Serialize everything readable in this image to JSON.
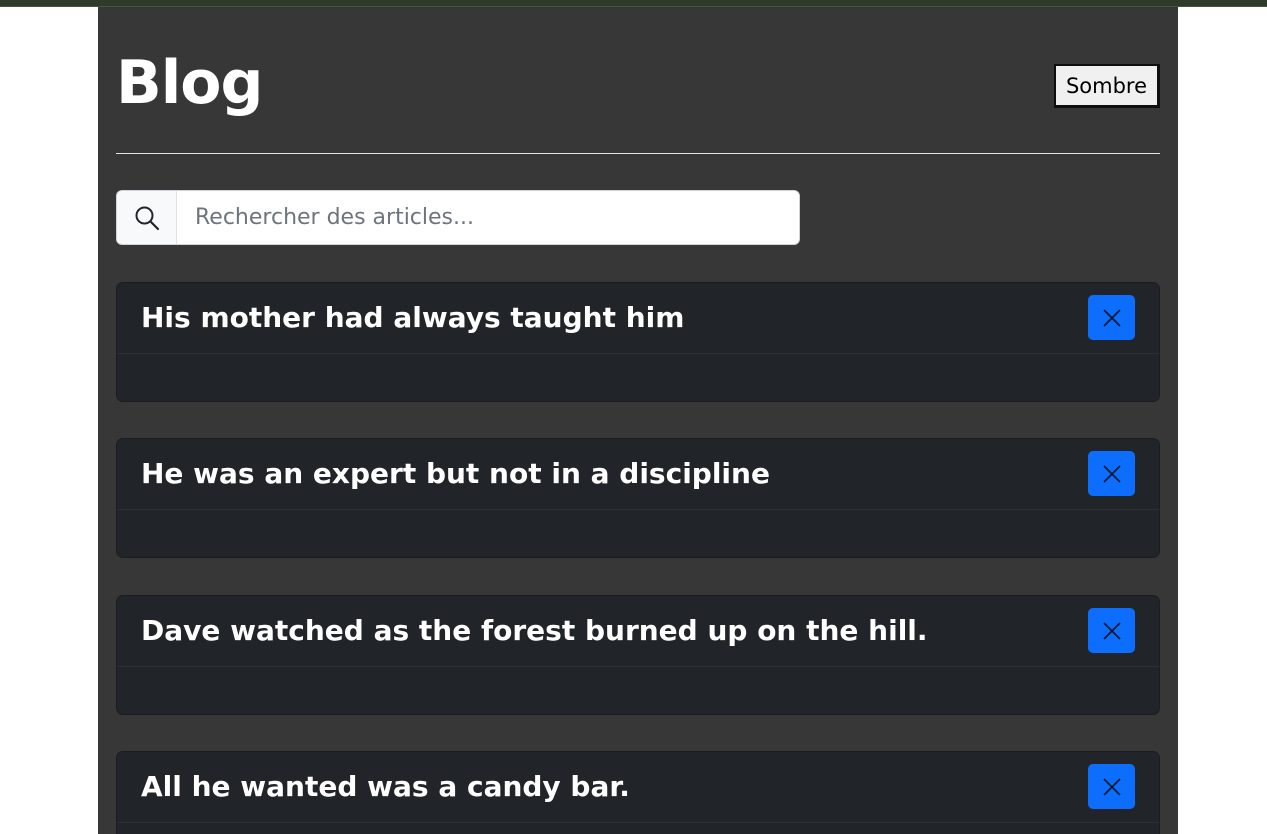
{
  "header": {
    "title": "Blog",
    "theme_toggle_label": "Sombre"
  },
  "search": {
    "placeholder": "Rechercher des articles...",
    "value": "",
    "icon": "search-icon"
  },
  "posts": [
    {
      "title": "His mother had always taught him",
      "delete_icon": "close-icon"
    },
    {
      "title": "He was an expert but not in a discipline",
      "delete_icon": "close-icon"
    },
    {
      "title": "Dave watched as the forest burned up on the hill.",
      "delete_icon": "close-icon"
    },
    {
      "title": "All he wanted was a candy bar.",
      "delete_icon": "close-icon"
    }
  ],
  "colors": {
    "page_background": "#373737",
    "card_background": "#212529",
    "accent": "#0d6efd",
    "top_bar": "#2f3b2a"
  }
}
